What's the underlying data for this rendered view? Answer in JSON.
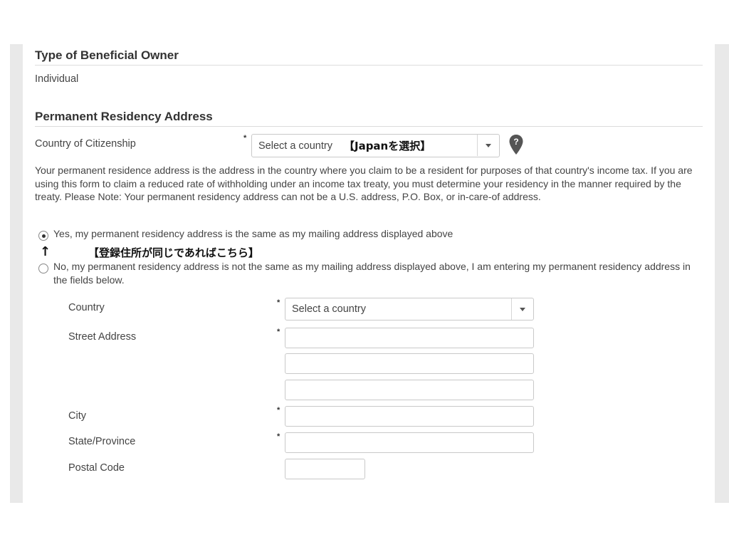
{
  "beneficial_owner": {
    "title": "Type of Beneficial Owner",
    "value": "Individual"
  },
  "residency": {
    "title": "Permanent Residency Address",
    "citizenship_label": "Country of Citizenship",
    "citizenship_select_value": "Select a country",
    "citizenship_annotation": "【Japanを選択】",
    "required_mark": "*",
    "info_text": "Your permanent residence address is the address in the country where you claim to be a resident for purposes of that country's income tax. If you are using this form to claim a reduced rate of withholding under an income tax treaty, you must determine your residency in the manner required by the treaty. Please Note: Your permanent residency address can not be a U.S. address, P.O. Box, or in-care-of address.",
    "option_yes": "Yes, my permanent residency address is the same as my mailing address displayed above",
    "option_yes_selected": true,
    "annotation_arrow": "↑",
    "annotation_yes": "【登録住所が同じであればこちら】",
    "option_no": "No, my permanent residency address is not the same as my mailing address displayed above, I am entering my permanent residency address in the fields below."
  },
  "address_form": {
    "country_label": "Country",
    "country_select_value": "Select a country",
    "street_label": "Street Address",
    "city_label": "City",
    "state_label": "State/Province",
    "postal_label": "Postal Code"
  },
  "icons": {
    "help": "map-marker-question-icon",
    "dropdown": "chevron-down-icon"
  }
}
